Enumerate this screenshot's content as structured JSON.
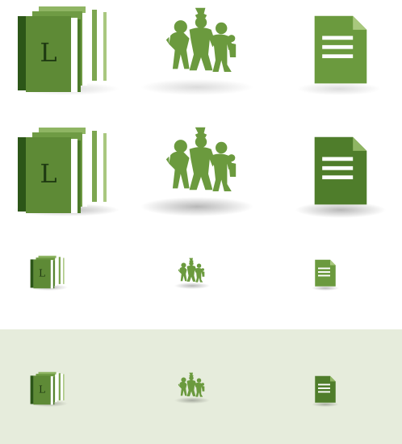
{
  "colors": {
    "dark_green": "#2f5a1b",
    "mid_green": "#5f8a3a",
    "light_green": "#84ab55",
    "pale_green": "#9cbf6e",
    "page_white": "#ffffff",
    "tint_background": "#e6ecdc"
  },
  "icons": {
    "library_letter": "L",
    "names": [
      "library-books-icon",
      "people-group-icon",
      "document-icon"
    ]
  },
  "rows": [
    {
      "name": "large-flat",
      "variant": "flat"
    },
    {
      "name": "large-deep-shadow",
      "variant": "deep"
    },
    {
      "name": "small-on-white",
      "variant": "small"
    },
    {
      "name": "small-on-tint",
      "variant": "small"
    }
  ]
}
